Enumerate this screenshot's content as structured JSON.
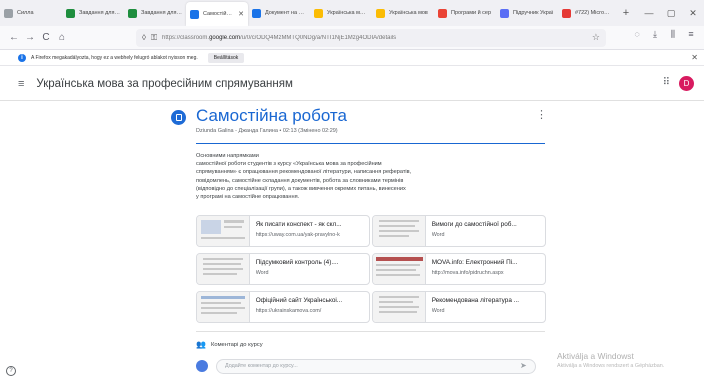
{
  "browser": {
    "tabs": [
      {
        "label": "Силла",
        "color": "#9aa0a6",
        "active": false
      },
      {
        "label": "Завдання для групи",
        "color": "#1e8e3e",
        "active": false
      },
      {
        "label": "Завдання для групи",
        "color": "#1e8e3e",
        "active": false
      },
      {
        "label": "Самостійна ро",
        "color": "#1a73e8",
        "active": true
      },
      {
        "label": "Документ на основі",
        "color": "#1a73e8",
        "active": false
      },
      {
        "label": "Українська мова",
        "color": "#fbbc04",
        "active": false
      },
      {
        "label": "Українська мов",
        "color": "#fbbc04",
        "active": false
      },
      {
        "label": "Програми й сер",
        "color": "#ea4335",
        "active": false
      },
      {
        "label": "Підручник Украї",
        "color": "#5b6ef5",
        "active": false
      },
      {
        "label": "#722) Microsoft Дикторія",
        "color": "#e53935",
        "active": false
      }
    ],
    "new_tab": "+",
    "url_prefix": "https://classroom.",
    "url_domain": "google.com",
    "url_rest": "/u/0/c/ODQ4MzMMTQ0NDg/a/NTI1NjE1Mzg4ODIA/details",
    "notification": {
      "text": "A Firefox megakadályozta, hogy ez a webhely felugró ablakot nyisson meg.",
      "button": "Beállítások"
    }
  },
  "classroom": {
    "course": "Українська мова за професійним спрямуванням",
    "avatar_letter": "D",
    "avatar_color": "#d81b60",
    "assignment": {
      "title": "Самостійна робота",
      "meta": "Dziunda Galina - Джанда Галина • 02:13 (Змінено 02:29)",
      "description": [
        "Основними напрямками",
        "самостійної роботи студентів з курсу «Українська мова за професійним",
        "спрямуванням» є опрацювання рекомендованої літератури, написання рефератів,",
        "повідомлень, самостійне складання документів, робота за словниками термінів",
        "(відповідно до спеціалізації групи), а також вивчення окремих питань, винесених",
        "у програмі на самостійне опрацювання."
      ],
      "attachments": [
        {
          "title": "Як писати конспект - як скл...",
          "subtitle": "https://uway.com.ua/yak-pravylno-k"
        },
        {
          "title": "Вимоги до самостійної роб...",
          "subtitle": "Word"
        },
        {
          "title": "Підсумковий контроль (4)....",
          "subtitle": "Word"
        },
        {
          "title": "MOVA.info: Електронний Пі...",
          "subtitle": "http://mova.info/pidruchn.aspx"
        },
        {
          "title": "Офіційний сайт Українськоі...",
          "subtitle": "https://ukrainskamova.com/"
        },
        {
          "title": "Рекомендована література ...",
          "subtitle": "Word"
        }
      ]
    },
    "comments": {
      "heading": "Коментарі до курсу",
      "placeholder": "Додайте коментар до курсу..."
    }
  },
  "os_watermark": {
    "title": "Aktiválja a Windowst",
    "subtitle": "Aktiválja a Windows rendszert a Gépházban."
  },
  "icons": {
    "back": "←",
    "forward": "→",
    "reload": "C",
    "home": "⌂",
    "shield": "◊",
    "lock": "🔒",
    "star": "☆",
    "menu": "≡",
    "apps": "⋮⋮⋮",
    "more": "⋮",
    "send": "➤",
    "help": "?"
  }
}
